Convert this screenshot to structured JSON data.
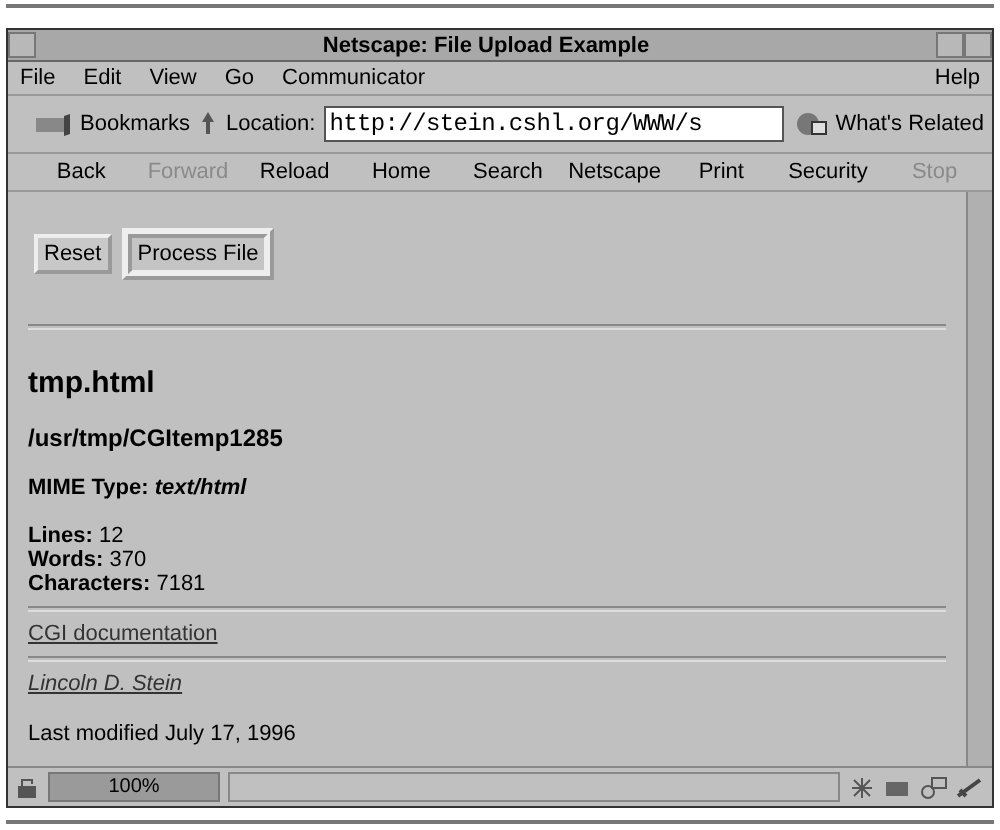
{
  "window": {
    "title": "Netscape: File Upload Example"
  },
  "menu": {
    "items": [
      "File",
      "Edit",
      "View",
      "Go",
      "Communicator"
    ],
    "help": "Help"
  },
  "location_bar": {
    "bookmarks": "Bookmarks",
    "location_label": "Location:",
    "url": "http://stein.cshl.org/WWW/s",
    "related": "What's Related"
  },
  "nav_buttons": [
    {
      "label": "Back",
      "disabled": false
    },
    {
      "label": "Forward",
      "disabled": true
    },
    {
      "label": "Reload",
      "disabled": false
    },
    {
      "label": "Home",
      "disabled": false
    },
    {
      "label": "Search",
      "disabled": false
    },
    {
      "label": "Netscape",
      "disabled": false
    },
    {
      "label": "Print",
      "disabled": false
    },
    {
      "label": "Security",
      "disabled": false
    },
    {
      "label": "Stop",
      "disabled": true
    }
  ],
  "content": {
    "form_buttons": [
      {
        "label": "Reset",
        "selected": false
      },
      {
        "label": "Process File",
        "selected": true
      }
    ],
    "heading": "tmp.html",
    "path": "/usr/tmp/CGItemp1285",
    "mime": {
      "label": "MIME Type:",
      "value": "text/html"
    },
    "stats": [
      {
        "label": "Lines:",
        "value": "12"
      },
      {
        "label": "Words:",
        "value": "370"
      },
      {
        "label": "Characters:",
        "value": "7181"
      }
    ],
    "doc_link": "CGI documentation",
    "author_link": "Lincoln D. Stein",
    "modified": "Last modified July 17, 1996"
  },
  "status_bar": {
    "progress": {
      "text": "100%",
      "level": 1
    }
  }
}
